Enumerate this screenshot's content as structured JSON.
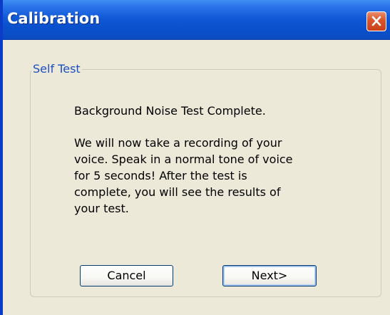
{
  "window": {
    "title": "Calibration",
    "close_icon": "close-x-icon"
  },
  "group": {
    "legend": "Self Test",
    "line1": "Background Noise Test Complete.",
    "paragraph_lines": [
      "We will now take a recording of your",
      "voice. Speak in a normal tone of voice",
      "for 5 seconds! After the test is",
      "complete, you will see the results of",
      "your test."
    ]
  },
  "buttons": {
    "cancel": "Cancel",
    "next": "Next>"
  },
  "colors": {
    "title_bar": "#0a50cc",
    "dialog_bg": "#ece9d8",
    "close_button": "#d9542b",
    "legend_text": "#1c4fc4"
  }
}
